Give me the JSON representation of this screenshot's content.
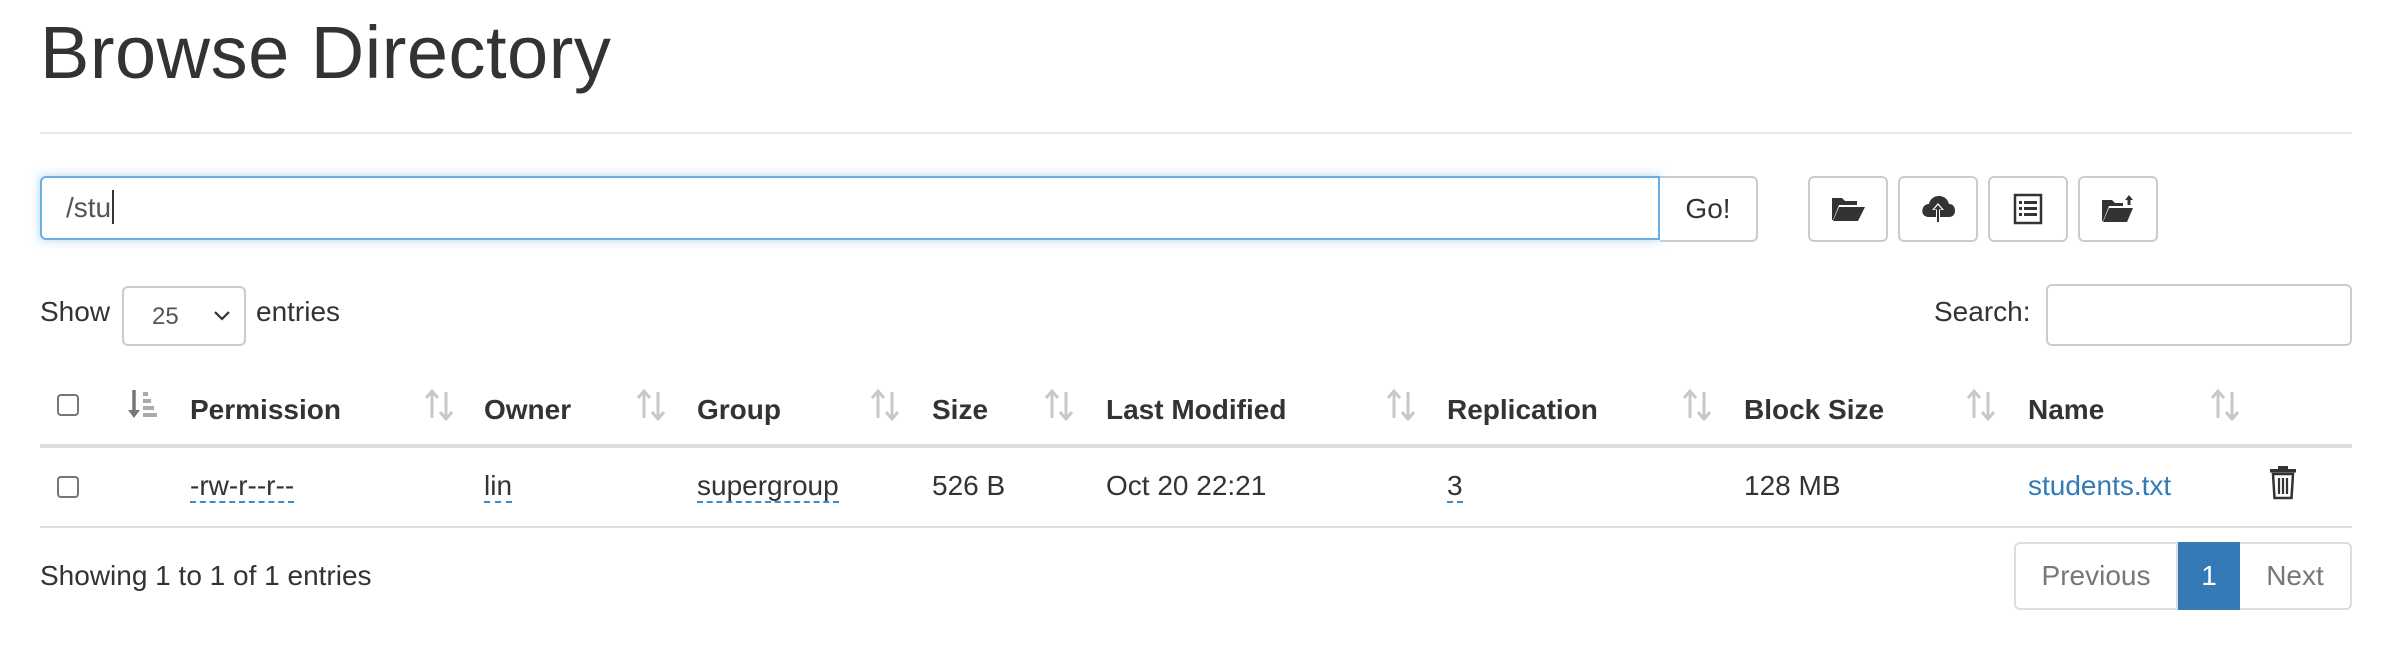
{
  "page_title": "Browse Directory",
  "path_bar": {
    "value": "/stu",
    "go_label": "Go!"
  },
  "toolbar": {
    "buttons": [
      {
        "icon": "folder-open-icon"
      },
      {
        "icon": "cloud-upload-icon"
      },
      {
        "icon": "list-alt-icon"
      },
      {
        "icon": "folder-move-icon"
      }
    ]
  },
  "length_menu": {
    "show_label": "Show",
    "selected": "25",
    "entries_label": "entries"
  },
  "search": {
    "label": "Search:",
    "value": ""
  },
  "table": {
    "columns": [
      "Permission",
      "Owner",
      "Group",
      "Size",
      "Last Modified",
      "Replication",
      "Block Size",
      "Name"
    ],
    "rows": [
      {
        "permission": "-rw-r--r--",
        "owner": "lin",
        "group": "supergroup",
        "size": "526 B",
        "last_modified": "Oct 20 22:21",
        "replication": "3",
        "block_size": "128 MB",
        "name": "students.txt"
      }
    ]
  },
  "footer": {
    "info": "Showing 1 to 1 of 1 entries",
    "previous_label": "Previous",
    "current_page": "1",
    "next_label": "Next"
  },
  "colors": {
    "link": "#337ab7",
    "focus_border": "#66afe9",
    "active_page": "#337ab7",
    "header_rule": "#dddddd"
  }
}
